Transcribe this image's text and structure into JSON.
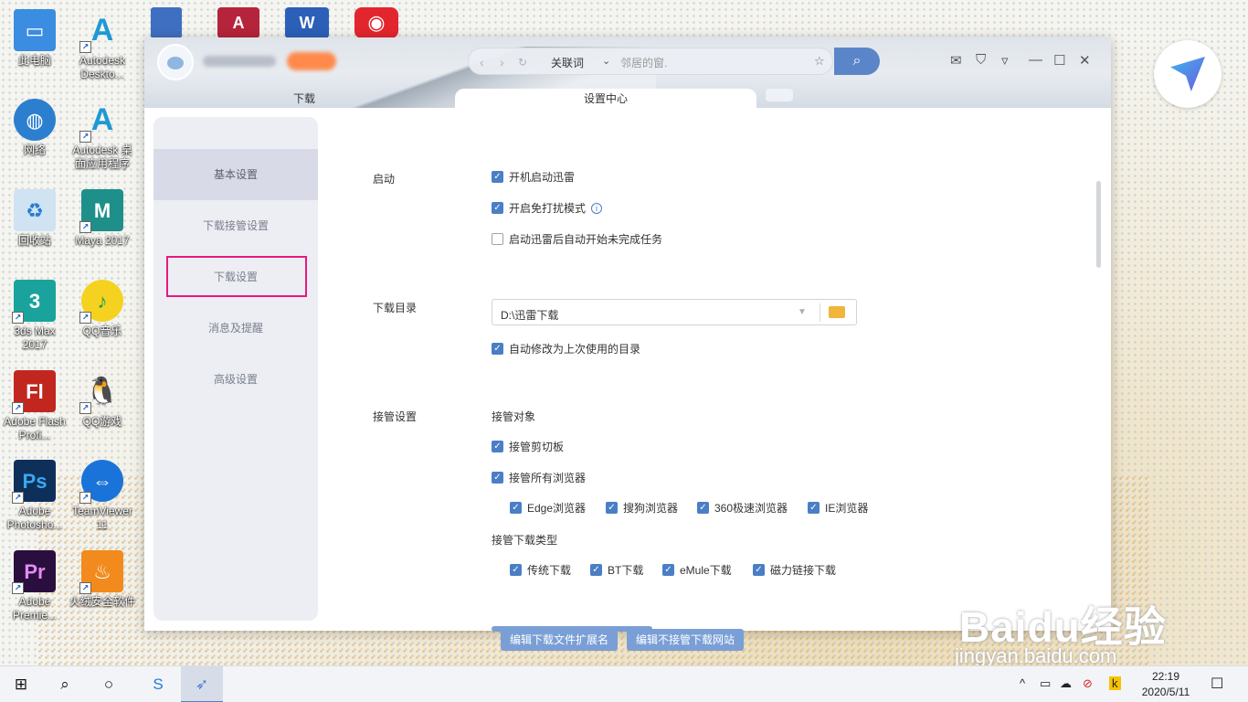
{
  "desktop_icons": [
    {
      "id": "pc",
      "label": "此电脑"
    },
    {
      "id": "autodesk1",
      "label": "Autodesk Deskto..."
    },
    {
      "id": "network",
      "label": "网络"
    },
    {
      "id": "autodesk2",
      "label": "Autodesk 桌面应用程序"
    },
    {
      "id": "recycle",
      "label": "回收站"
    },
    {
      "id": "maya",
      "label": "Maya 2017"
    },
    {
      "id": "max",
      "label": "3ds Max 2017"
    },
    {
      "id": "qqmusic",
      "label": "QQ音乐"
    },
    {
      "id": "flash",
      "label": "Adobe Flash Profi..."
    },
    {
      "id": "qqgame",
      "label": "QQ游戏"
    },
    {
      "id": "ps",
      "label": "Adobe Photosho..."
    },
    {
      "id": "teamviewer",
      "label": "TeamViewer 11"
    },
    {
      "id": "pr",
      "label": "Adobe Premie..."
    },
    {
      "id": "huorong",
      "label": "火绒安全软件"
    }
  ],
  "app": {
    "search": {
      "keyword_label": "关联词",
      "placeholder": "邻居的窗."
    },
    "tabs": [
      {
        "label": "下载"
      },
      {
        "label": "设置中心"
      }
    ],
    "sidebar": [
      {
        "label": "基本设置"
      },
      {
        "label": "下载接管设置"
      },
      {
        "label": "下载设置"
      },
      {
        "label": "消息及提醒"
      },
      {
        "label": "高级设置"
      }
    ],
    "startup": {
      "label": "启动",
      "options": [
        {
          "label": "开机启动迅雷",
          "checked": true
        },
        {
          "label": "开启免打扰模式",
          "checked": true
        },
        {
          "label": "启动迅雷后自动开始未完成任务",
          "checked": false
        }
      ]
    },
    "download_dir": {
      "label": "下载目录",
      "value": "D:\\迅雷下载",
      "auto_option": "自动修改为上次使用的目录"
    },
    "takeover": {
      "label": "接管设置",
      "object_label": "接管对象",
      "clipboard": "接管剪切板",
      "all_browsers": "接管所有浏览器",
      "browsers": [
        "Edge浏览器",
        "搜狗浏览器",
        "360极速浏览器",
        "IE浏览器"
      ],
      "type_label": "接管下载类型",
      "types": [
        "传统下载",
        "BT下载",
        "eMule下载",
        "磁力链接下载"
      ],
      "btn_ext": "编辑下载文件扩展名",
      "btn_sites": "编辑不接管下载网站"
    }
  },
  "watermark": {
    "brand": "Baidu经验",
    "url": "jingyan.baidu.com"
  },
  "taskbar": {
    "time": "22:19",
    "date": "2020/5/11"
  },
  "colors": {
    "accent": "#4a7fc6",
    "highlight": "#e8197e"
  }
}
